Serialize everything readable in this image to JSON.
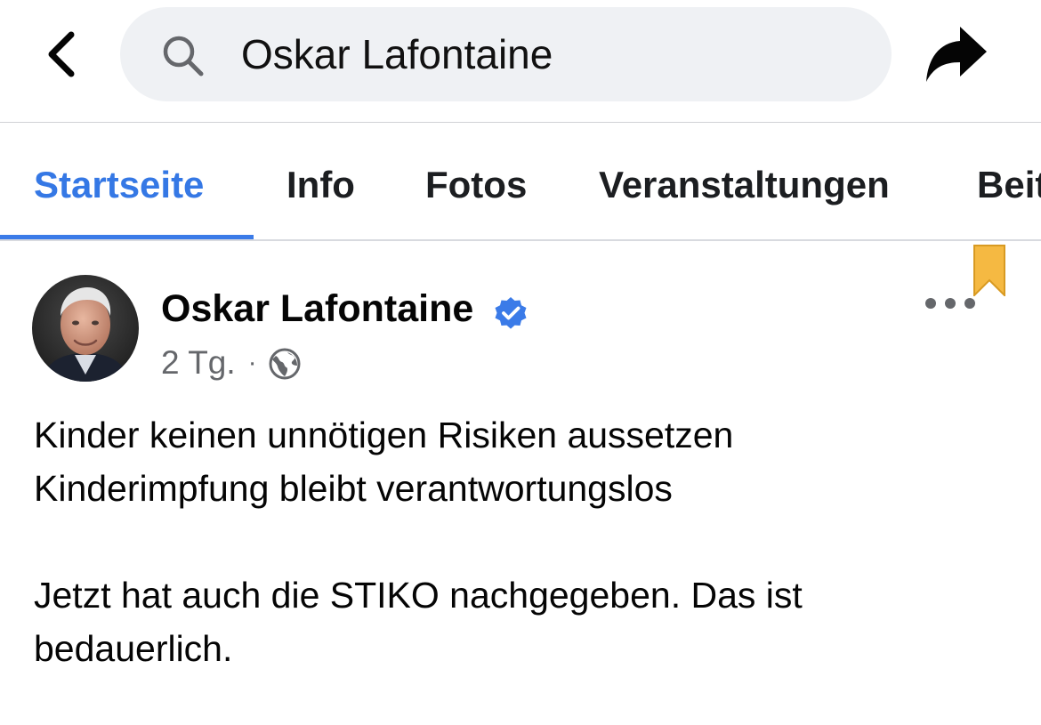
{
  "header": {
    "search_value": "Oskar Lafontaine",
    "back_icon": "chevron-left-icon",
    "search_icon": "magnifier-icon",
    "share_icon": "share-arrow-icon"
  },
  "tabs": [
    {
      "label": "Startseite",
      "active": true
    },
    {
      "label": "Info",
      "active": false
    },
    {
      "label": "Fotos",
      "active": false
    },
    {
      "label": "Veranstaltungen",
      "active": false
    },
    {
      "label": "Beit",
      "active": false
    }
  ],
  "post": {
    "author": "Oskar Lafontaine",
    "verified": true,
    "time": "2 Tg.",
    "separator": "·",
    "audience_icon": "globe-icon",
    "lines": [
      "Kinder keinen unnötigen Risiken aussetzen",
      "Kinderimpfung bleibt verantwortungslos",
      "",
      "Jetzt hat auch die STIKO nachgegeben. Das ist",
      "bedauerlich."
    ]
  },
  "colors": {
    "accent": "#3578e5",
    "bookmark": "#f5b942",
    "search_bg": "#eff1f4",
    "secondary_text": "#65676b"
  }
}
